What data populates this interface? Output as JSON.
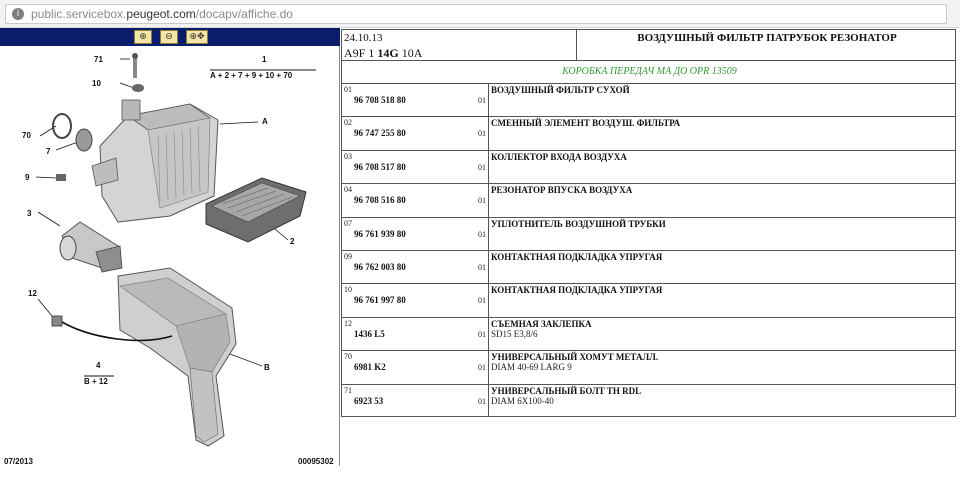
{
  "browser": {
    "url_prefix": "public.servicebox.",
    "url_domain": "peugeot.com",
    "url_path": "/docapv/affiche.do",
    "site_icon": "info-icon"
  },
  "toolbar": {
    "buttons": [
      {
        "name": "zoom-in-button",
        "icon": "zoom-in-icon",
        "glyph": "+"
      },
      {
        "name": "zoom-out-button",
        "icon": "zoom-out-icon",
        "glyph": "−"
      },
      {
        "name": "zoom-pan-button",
        "icon": "zoom-pan-icon",
        "glyph": "✥"
      }
    ]
  },
  "diagram": {
    "callouts": [
      "71",
      "1",
      "A + 2 + 7 + 9 + 10 + 70",
      "10",
      "A",
      "70",
      "7",
      "9",
      "3",
      "2",
      "12",
      "4",
      "B + 12",
      "B"
    ],
    "date": "07/2013",
    "code": "00095302"
  },
  "sheet": {
    "date": "24.10.13",
    "model_a": "A9F 1 ",
    "model_b": "14G",
    "model_c": " 10A",
    "title": "ВОЗДУШНЫЙ ФИЛЬТР ПАТРУБОК РЕЗОНАТОР",
    "subtitle": "КОРОБКА ПЕРЕДАЧ МА ДО OPR 13509",
    "rows": [
      {
        "pos": "01",
        "ref": "96 708 518 80",
        "qty": "01",
        "desc": "ВОЗДУШНЫЙ ФИЛЬТР СУХОЙ",
        "note": ""
      },
      {
        "pos": "02",
        "ref": "96 747 255 80",
        "qty": "01",
        "desc": "СМЕННЫЙ ЭЛЕМЕНТ ВОЗДУШ. ФИЛЬТРА",
        "note": ""
      },
      {
        "pos": "03",
        "ref": "96 708 517 80",
        "qty": "01",
        "desc": "КОЛЛЕКТОР ВХОДА ВОЗДУХА",
        "note": ""
      },
      {
        "pos": "04",
        "ref": "96 708 516 80",
        "qty": "01",
        "desc": "РЕЗОНАТОР ВПУСКА ВОЗДУХА",
        "note": ""
      },
      {
        "pos": "07",
        "ref": "96 761 939 80",
        "qty": "01",
        "desc": "УПЛОТНИТЕЛЬ ВОЗДУШНОЙ ТРУБКИ",
        "note": ""
      },
      {
        "pos": "09",
        "ref": "96 762 003 80",
        "qty": "01",
        "desc": "КОНТАКТНАЯ ПОДКЛАДКА УПРУГАЯ",
        "note": ""
      },
      {
        "pos": "10",
        "ref": "96 761 997 80",
        "qty": "01",
        "desc": "КОНТАКТНАЯ ПОДКЛАДКА УПРУГАЯ",
        "note": ""
      },
      {
        "pos": "12",
        "ref": "1436 L5",
        "qty": "01",
        "desc": "СЪЕМНАЯ ЗАКЛЕПКА",
        "note": "SD15 E3,8/6"
      },
      {
        "pos": "70",
        "ref": "6981 K2",
        "qty": "01",
        "desc": "УНИВЕРСАЛЬНЫЙ ХОМУТ МЕТАЛЛ.",
        "note": "DIAM 40-69 LARG 9"
      },
      {
        "pos": "71",
        "ref": "6923 53",
        "qty": "01",
        "desc": "УНИВЕРСАЛЬНЫЙ БОЛТ TH RDL",
        "note": "DIAM 6X100-40"
      }
    ]
  }
}
